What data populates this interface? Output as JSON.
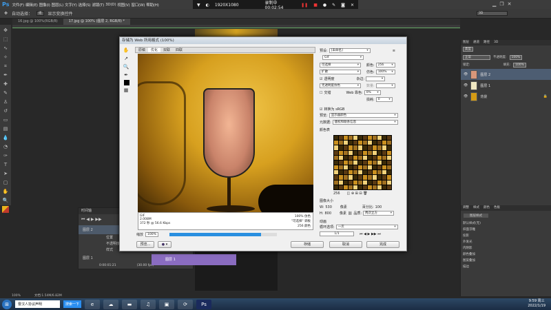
{
  "app": {
    "logo": "Ps",
    "menus": [
      "文件(F)",
      "编辑(E)",
      "图像(I)",
      "图层(L)",
      "文字(Y)",
      "选择(S)",
      "滤镜(T)",
      "3D(D)",
      "视图(V)",
      "窗口(W)",
      "帮助(H)"
    ]
  },
  "options": {
    "auto_select": "自动选择：",
    "auto_select_value": "组",
    "show_transform": "显示变换控件",
    "workspace": "3D"
  },
  "doc_tabs": [
    "16.jpg @ 100%(RGB/8)",
    "17.jpg @ 100% (图层 2, RGB/8) *"
  ],
  "recorder": {
    "resolution": "1920X1080",
    "status": "录制中 00:02:54"
  },
  "dialog": {
    "title": "存储为 Web 所用格式 (100%)",
    "tabs": [
      "原稿",
      "优化",
      "双联",
      "四联"
    ],
    "info_left": [
      "GIF",
      "2.008M",
      "372 秒 @ 56.6 Kbps"
    ],
    "info_right": [
      "100% 仿色",
      "\"可选择\" 调板",
      "256 颜色"
    ],
    "zoom": "100%",
    "zoom_label": "缩放",
    "progress": 0.85,
    "preview_button": "预览...",
    "save_button": "存储",
    "cancel_button": "取消",
    "done_button": "完成",
    "settings": {
      "preset_label": "预设:",
      "preset": "[未命名]",
      "format": "GIF",
      "reduction": "可选择",
      "dither_algo": "扩散",
      "colors_label": "颜色:",
      "colors": "256",
      "dither_label": "仿色:",
      "dither": "100%",
      "transparency": "透明度",
      "matte_label": "杂边:",
      "trans_dither": "无透明度仿色",
      "amount_label": "数量:",
      "interlaced": "交错",
      "web_snap_label": "Web 靠色:",
      "web_snap": "0%",
      "lossy_label": "损耗:",
      "lossy": "0",
      "srgb": "转换为 sRGB",
      "preview_label": "预览:",
      "preview": "显示器颜色",
      "metadata_label": "元数据:",
      "metadata": "版权和联系信息",
      "color_table": "颜色表",
      "color_count": "256",
      "image_size": "图像大小",
      "w_label": "W:",
      "w": "530",
      "h_label": "H:",
      "h": "800",
      "unit": "像素",
      "percent_label": "百分比:",
      "percent": "100",
      "quality_label": "品质:",
      "quality": "两次立方",
      "animation": "动画",
      "loop_label": "循环选项:",
      "loop": "一次",
      "frame": "1/1"
    }
  },
  "layers": {
    "tabs": [
      "图层",
      "通道",
      "路径",
      "3D"
    ],
    "kind": "类型",
    "blend": "正常",
    "opacity_label": "不透明度:",
    "opacity": "100%",
    "lock_label": "锁定:",
    "fill_label": "填充:",
    "fill": "100%",
    "items": [
      "图层 2",
      "图层 1",
      "背景"
    ]
  },
  "adjust": {
    "tabs": [
      "调整",
      "样式",
      "颜色",
      "色板"
    ],
    "preset_button": "图层样式",
    "items": [
      "默认样式(无)",
      "斜面浮雕",
      "投影",
      "外发光",
      "内阴影",
      "颜色叠加",
      "图案叠加",
      "描边"
    ]
  },
  "timeline": {
    "title": "时间轴",
    "tracks": [
      "图层 2",
      "位置",
      "不透明度",
      "样式",
      "图层 1"
    ],
    "clip": "图层 1",
    "time": "0:00:01:21",
    "fps": "(30.00 fps)"
  },
  "status": {
    "zoom": "100%",
    "doc": "文档:1.54M/6.82M"
  },
  "taskbar": {
    "search": "曹汉人协议声明",
    "search_btn": "搜索一下",
    "time": "9:59 周三",
    "date": "2022/1/19"
  }
}
